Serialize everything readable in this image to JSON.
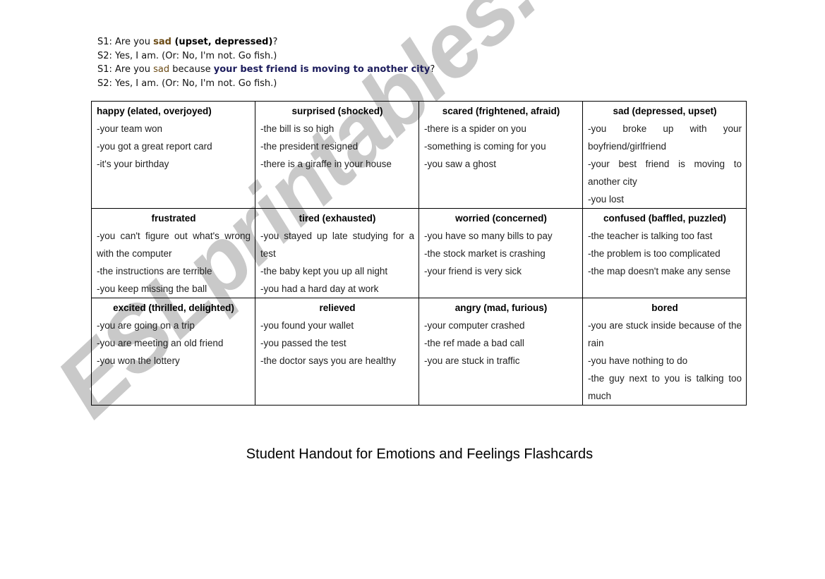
{
  "watermark": "ESLprintables.com",
  "intro": {
    "line1": {
      "prefix": "S1: Are you ",
      "emotion": "sad",
      "synonyms": " (upset, depressed)",
      "suffix": "?"
    },
    "line2": "S2: Yes, I am. (Or: No, I'm not. Go fish.)",
    "line3": {
      "prefix": "S1: Are you ",
      "emotion": "sad",
      "middle": " because ",
      "reason": "your best friend is moving to another city",
      "suffix": "?"
    },
    "line4": "S2: Yes, I am. (Or: No, I'm not. Go fish.)"
  },
  "colors": {
    "emotion_word": "#6b4a14",
    "reason": "#1c1c5c",
    "watermark": "#c9c9c9"
  },
  "table": {
    "rows": [
      [
        {
          "title": "happy (elated, overjoyed)",
          "items": [
            "-your team won",
            "-you got a great report card",
            "-it's your birthday"
          ]
        },
        {
          "title": "surprised (shocked)",
          "items": [
            "-the bill is so high",
            "-the president resigned",
            "-there is a giraffe in your house"
          ]
        },
        {
          "title": "scared (frightened, afraid)",
          "items": [
            "-there is a spider on you",
            "-something is coming for you",
            "-you saw a ghost"
          ]
        },
        {
          "title": "sad (depressed, upset)",
          "items": [
            "-you broke up with your boyfriend/girlfriend",
            "-your best friend is moving to another city",
            "-you lost"
          ]
        }
      ],
      [
        {
          "title": "frustrated",
          "items": [
            "-you can't figure out what's wrong with the computer",
            "-the instructions are terrible",
            "-you keep missing the ball"
          ]
        },
        {
          "title": "tired (exhausted)",
          "items": [
            "-you stayed up late studying for a test",
            "-the baby kept you up all night",
            "-you had a hard day at work"
          ]
        },
        {
          "title": "worried (concerned)",
          "items": [
            "-you have so many bills to pay",
            "-the stock market is crashing",
            "-your friend is very sick"
          ]
        },
        {
          "title": "confused (baffled, puzzled)",
          "items": [
            "-the teacher is talking too fast",
            "-the problem is too complicated",
            "-the map doesn't make any sense"
          ]
        }
      ],
      [
        {
          "title": "excited (thrilled, delighted)",
          "items": [
            "-you are going on a trip",
            "-you are meeting an old friend",
            "-you won the lottery"
          ]
        },
        {
          "title": "relieved",
          "items": [
            "-you found your wallet",
            "-you passed the test",
            "-the doctor says you are healthy"
          ]
        },
        {
          "title": "angry (mad, furious)",
          "items": [
            "-your computer crashed",
            "-the ref made a bad call",
            "-you are stuck in traffic"
          ]
        },
        {
          "title": "bored",
          "items": [
            "-you are stuck inside because of the rain",
            "-you have nothing to do",
            "-the guy next to you is talking too much"
          ]
        }
      ]
    ]
  },
  "caption": "Student Handout for Emotions and Feelings Flashcards"
}
